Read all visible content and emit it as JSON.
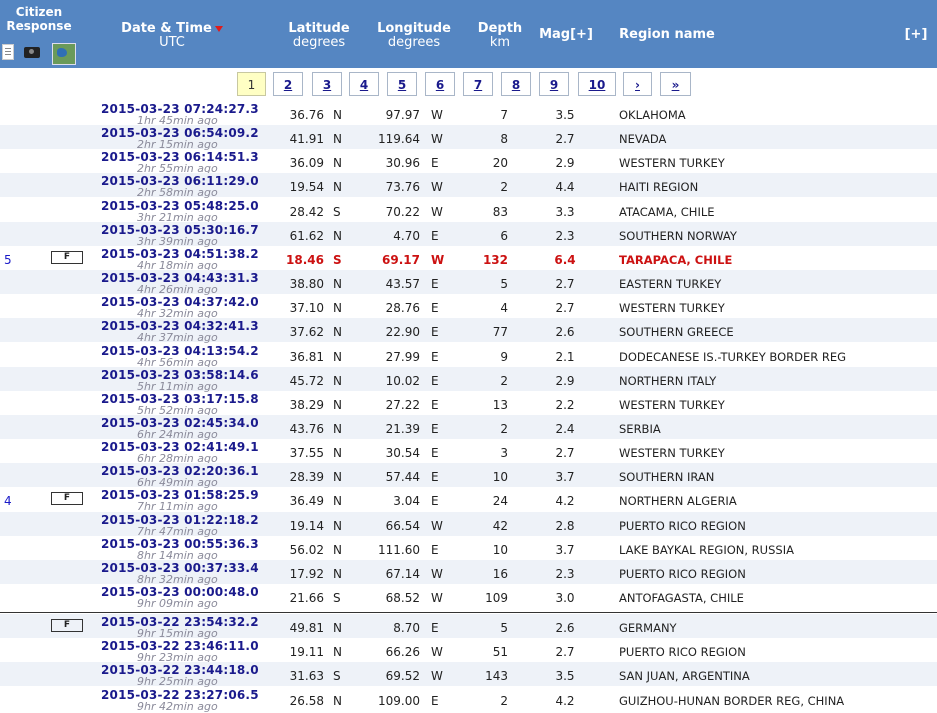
{
  "header": {
    "citizen_response": "Citizen Response",
    "date_time": "Date & Time",
    "date_time_sub": "UTC",
    "latitude": "Latitude",
    "latitude_sub": "degrees",
    "longitude": "Longitude",
    "longitude_sub": "degrees",
    "depth": "Depth",
    "depth_sub": "km",
    "magnitude": "Mag[+]",
    "region": "Region name",
    "expand": "[+]",
    "icons": [
      "document-icon",
      "camera-icon",
      "map-icon"
    ]
  },
  "pager": [
    "1",
    "2",
    "3",
    "4",
    "5",
    "6",
    "7",
    "8",
    "9",
    "10",
    "›",
    "»"
  ],
  "pager_current": "1",
  "colors": {
    "header_bg": "#5586c2",
    "alt_row": "#eef2f8",
    "highlight": "#cc1111",
    "link": "#1a1a8c"
  },
  "rows": [
    {
      "num": "",
      "f": "",
      "dt": "2015-03-23   07:24:27.3",
      "ago": "1hr 45min ago",
      "lat": "36.76",
      "ns": "N",
      "lon": "97.97",
      "ew": "W",
      "dep": "7",
      "mag": "3.5",
      "reg": "OKLAHOMA"
    },
    {
      "num": "",
      "f": "",
      "dt": "2015-03-23   06:54:09.2",
      "ago": "2hr 15min ago",
      "lat": "41.91",
      "ns": "N",
      "lon": "119.64",
      "ew": "W",
      "dep": "8",
      "mag": "2.7",
      "reg": "NEVADA"
    },
    {
      "num": "",
      "f": "",
      "dt": "2015-03-23   06:14:51.3",
      "ago": "2hr 55min ago",
      "lat": "36.09",
      "ns": "N",
      "lon": "30.96",
      "ew": "E",
      "dep": "20",
      "mag": "2.9",
      "reg": "WESTERN TURKEY"
    },
    {
      "num": "",
      "f": "",
      "dt": "2015-03-23   06:11:29.0",
      "ago": "2hr 58min ago",
      "lat": "19.54",
      "ns": "N",
      "lon": "73.76",
      "ew": "W",
      "dep": "2",
      "mag": "4.4",
      "reg": "HAITI REGION"
    },
    {
      "num": "",
      "f": "",
      "dt": "2015-03-23   05:48:25.0",
      "ago": "3hr 21min ago",
      "lat": "28.42",
      "ns": "S",
      "lon": "70.22",
      "ew": "W",
      "dep": "83",
      "mag": "3.3",
      "reg": "ATACAMA, CHILE"
    },
    {
      "num": "",
      "f": "",
      "dt": "2015-03-23   05:30:16.7",
      "ago": "3hr 39min ago",
      "lat": "61.62",
      "ns": "N",
      "lon": "4.70",
      "ew": "E",
      "dep": "6",
      "mag": "2.3",
      "reg": "SOUTHERN NORWAY"
    },
    {
      "num": "5",
      "f": "F",
      "dt": "2015-03-23   04:51:38.2",
      "ago": "4hr 18min ago",
      "lat": "18.46",
      "ns": "S",
      "lon": "69.17",
      "ew": "W",
      "dep": "132",
      "mag": "6.4",
      "reg": "TARAPACA, CHILE",
      "hl": true
    },
    {
      "num": "",
      "f": "",
      "dt": "2015-03-23   04:43:31.3",
      "ago": "4hr 26min ago",
      "lat": "38.80",
      "ns": "N",
      "lon": "43.57",
      "ew": "E",
      "dep": "5",
      "mag": "2.7",
      "reg": "EASTERN TURKEY"
    },
    {
      "num": "",
      "f": "",
      "dt": "2015-03-23   04:37:42.0",
      "ago": "4hr 32min ago",
      "lat": "37.10",
      "ns": "N",
      "lon": "28.76",
      "ew": "E",
      "dep": "4",
      "mag": "2.7",
      "reg": "WESTERN TURKEY"
    },
    {
      "num": "",
      "f": "",
      "dt": "2015-03-23   04:32:41.3",
      "ago": "4hr 37min ago",
      "lat": "37.62",
      "ns": "N",
      "lon": "22.90",
      "ew": "E",
      "dep": "77",
      "mag": "2.6",
      "reg": "SOUTHERN GREECE"
    },
    {
      "num": "",
      "f": "",
      "dt": "2015-03-23   04:13:54.2",
      "ago": "4hr 56min ago",
      "lat": "36.81",
      "ns": "N",
      "lon": "27.99",
      "ew": "E",
      "dep": "9",
      "mag": "2.1",
      "reg": "DODECANESE IS.-TURKEY BORDER REG"
    },
    {
      "num": "",
      "f": "",
      "dt": "2015-03-23   03:58:14.6",
      "ago": "5hr 11min ago",
      "lat": "45.72",
      "ns": "N",
      "lon": "10.02",
      "ew": "E",
      "dep": "2",
      "mag": "2.9",
      "reg": "NORTHERN ITALY"
    },
    {
      "num": "",
      "f": "",
      "dt": "2015-03-23   03:17:15.8",
      "ago": "5hr 52min ago",
      "lat": "38.29",
      "ns": "N",
      "lon": "27.22",
      "ew": "E",
      "dep": "13",
      "mag": "2.2",
      "reg": "WESTERN TURKEY"
    },
    {
      "num": "",
      "f": "",
      "dt": "2015-03-23   02:45:34.0",
      "ago": "6hr 24min ago",
      "lat": "43.76",
      "ns": "N",
      "lon": "21.39",
      "ew": "E",
      "dep": "2",
      "mag": "2.4",
      "reg": "SERBIA"
    },
    {
      "num": "",
      "f": "",
      "dt": "2015-03-23   02:41:49.1",
      "ago": "6hr 28min ago",
      "lat": "37.55",
      "ns": "N",
      "lon": "30.54",
      "ew": "E",
      "dep": "3",
      "mag": "2.7",
      "reg": "WESTERN TURKEY"
    },
    {
      "num": "",
      "f": "",
      "dt": "2015-03-23   02:20:36.1",
      "ago": "6hr 49min ago",
      "lat": "28.39",
      "ns": "N",
      "lon": "57.44",
      "ew": "E",
      "dep": "10",
      "mag": "3.7",
      "reg": "SOUTHERN IRAN"
    },
    {
      "num": "4",
      "f": "F",
      "dt": "2015-03-23   01:58:25.9",
      "ago": "7hr 11min ago",
      "lat": "36.49",
      "ns": "N",
      "lon": "3.04",
      "ew": "E",
      "dep": "24",
      "mag": "4.2",
      "reg": "NORTHERN ALGERIA"
    },
    {
      "num": "",
      "f": "",
      "dt": "2015-03-23   01:22:18.2",
      "ago": "7hr 47min ago",
      "lat": "19.14",
      "ns": "N",
      "lon": "66.54",
      "ew": "W",
      "dep": "42",
      "mag": "2.8",
      "reg": "PUERTO RICO REGION"
    },
    {
      "num": "",
      "f": "",
      "dt": "2015-03-23   00:55:36.3",
      "ago": "8hr 14min ago",
      "lat": "56.02",
      "ns": "N",
      "lon": "111.60",
      "ew": "E",
      "dep": "10",
      "mag": "3.7",
      "reg": "LAKE BAYKAL REGION, RUSSIA"
    },
    {
      "num": "",
      "f": "",
      "dt": "2015-03-23   00:37:33.4",
      "ago": "8hr 32min ago",
      "lat": "17.92",
      "ns": "N",
      "lon": "67.14",
      "ew": "W",
      "dep": "16",
      "mag": "2.3",
      "reg": "PUERTO RICO REGION"
    },
    {
      "num": "",
      "f": "",
      "dt": "2015-03-23   00:00:48.0",
      "ago": "9hr 09min ago",
      "lat": "21.66",
      "ns": "S",
      "lon": "68.52",
      "ew": "W",
      "dep": "109",
      "mag": "3.0",
      "reg": "ANTOFAGASTA, CHILE"
    },
    {
      "num": "",
      "f": "F",
      "dt": "2015-03-22   23:54:32.2",
      "ago": "9hr 15min ago",
      "lat": "49.81",
      "ns": "N",
      "lon": "8.70",
      "ew": "E",
      "dep": "5",
      "mag": "2.6",
      "reg": "GERMANY"
    },
    {
      "num": "",
      "f": "",
      "dt": "2015-03-22   23:46:11.0",
      "ago": "9hr 23min ago",
      "lat": "19.11",
      "ns": "N",
      "lon": "66.26",
      "ew": "W",
      "dep": "51",
      "mag": "2.7",
      "reg": "PUERTO RICO REGION"
    },
    {
      "num": "",
      "f": "",
      "dt": "2015-03-22   23:44:18.0",
      "ago": "9hr 25min ago",
      "lat": "31.63",
      "ns": "S",
      "lon": "69.52",
      "ew": "W",
      "dep": "143",
      "mag": "3.5",
      "reg": "SAN JUAN, ARGENTINA"
    },
    {
      "num": "",
      "f": "",
      "dt": "2015-03-22   23:27:06.5",
      "ago": "9hr 42min ago",
      "lat": "26.58",
      "ns": "N",
      "lon": "109.00",
      "ew": "E",
      "dep": "2",
      "mag": "4.2",
      "reg": "GUIZHOU-HUNAN BORDER REG, CHINA"
    }
  ]
}
